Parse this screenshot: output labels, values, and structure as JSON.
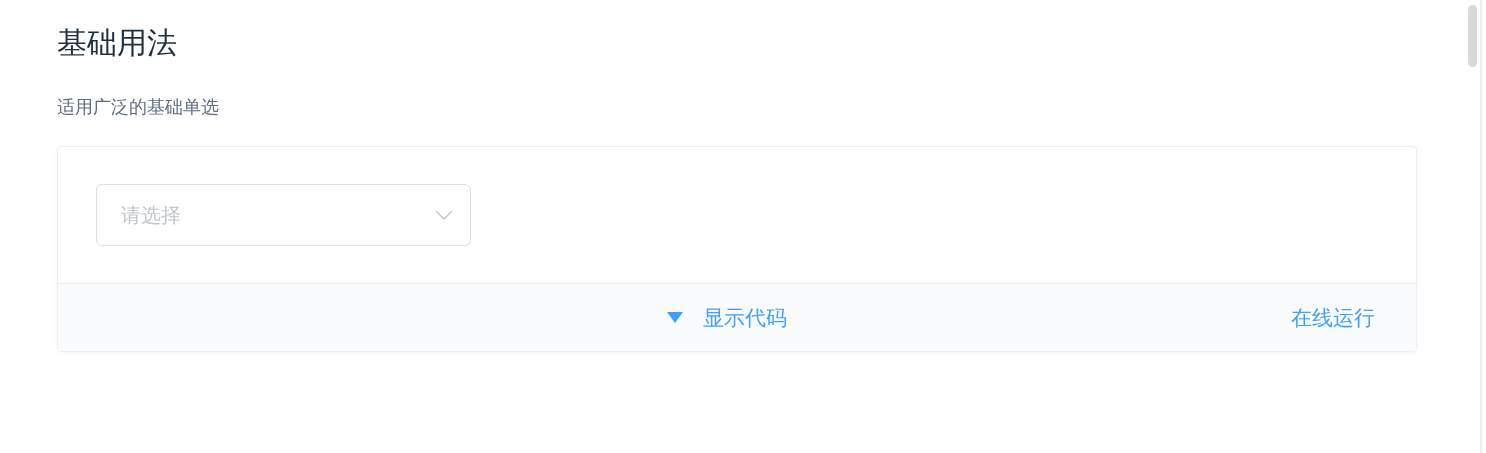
{
  "section": {
    "title": "基础用法",
    "description": "适用广泛的基础单选"
  },
  "demo": {
    "select": {
      "placeholder": "请选择"
    },
    "footer": {
      "toggle_label": "显示代码",
      "run_link": "在线运行"
    }
  }
}
